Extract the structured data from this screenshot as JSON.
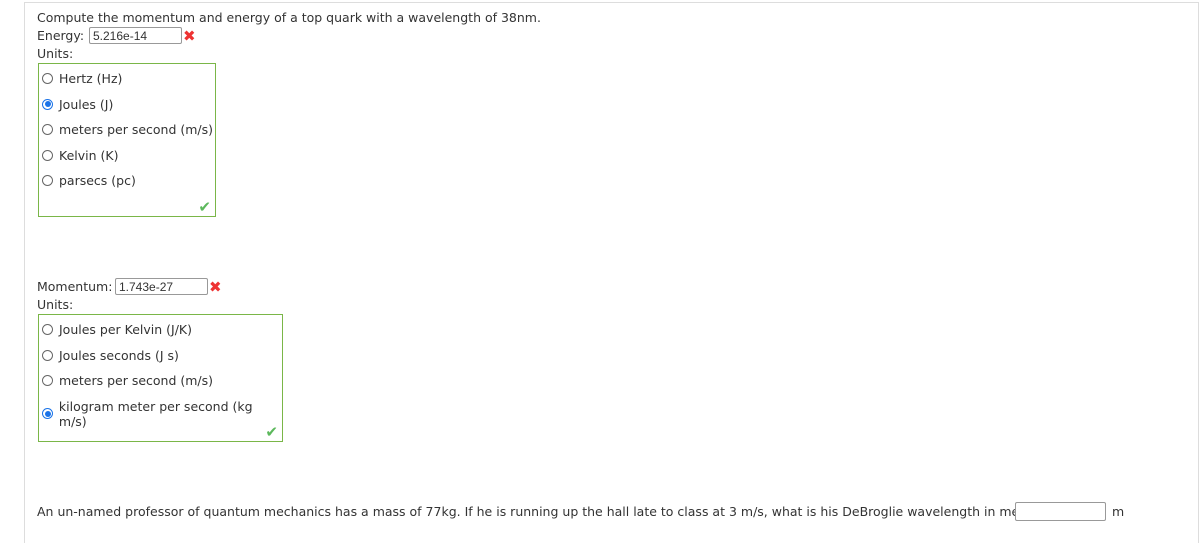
{
  "q1": {
    "prompt": "Compute the momentum and energy of a top quark with a wavelength of 38nm.",
    "energy_label": "Energy:",
    "energy_value": "5.216e-14",
    "units_label": "Units:",
    "energy_units": [
      {
        "label": "Hertz (Hz)",
        "selected": false
      },
      {
        "label": "Joules (J)",
        "selected": true
      },
      {
        "label": "meters per second (m/s)",
        "selected": false
      },
      {
        "label": "Kelvin (K)",
        "selected": false
      },
      {
        "label": "parsecs (pc)",
        "selected": false
      }
    ],
    "momentum_label": "Momentum:",
    "momentum_value": "1.743e-27",
    "momentum_units": [
      {
        "label": "Joules per Kelvin (J/K)",
        "selected": false
      },
      {
        "label": "Joules seconds (J s)",
        "selected": false
      },
      {
        "label": "meters per second (m/s)",
        "selected": false
      },
      {
        "label": "kilogram meter per second (kg m/s)",
        "selected": true
      }
    ],
    "wrong_icon": "✖",
    "correct_icon": "✔"
  },
  "q2": {
    "prompt": "An un-named professor of quantum mechanics has a mass of 77kg. If he is running up the hall late to class at 3 m/s, what is his DeBroglie wavelength in meters?",
    "value": "",
    "unit": "m"
  }
}
